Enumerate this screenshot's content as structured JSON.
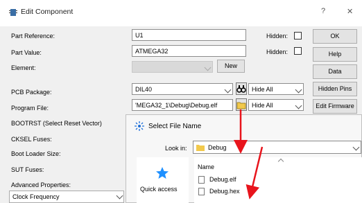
{
  "window": {
    "title": "Edit Component",
    "help": "?",
    "close": "✕"
  },
  "form": {
    "part_reference": {
      "label": "Part Reference:",
      "value": "U1",
      "hidden_label": "Hidden:"
    },
    "part_value": {
      "label": "Part Value:",
      "value": "ATMEGA32",
      "hidden_label": "Hidden:"
    },
    "element": {
      "label": "Element:",
      "new_button": "New"
    },
    "pcb_package": {
      "label": "PCB Package:",
      "value": "DIL40",
      "hide_option": "Hide All"
    },
    "program_file": {
      "label": "Program File:",
      "value": "'MEGA32_1\\Debug\\Debug.elf",
      "hide_option": "Hide All"
    },
    "bootrst": {
      "label": "BOOTRST (Select Reset Vector)"
    },
    "cksel": {
      "label": "CKSEL Fuses:"
    },
    "boot_loader": {
      "label": "Boot Loader Size:"
    },
    "sut": {
      "label": "SUT Fuses:"
    },
    "advanced": {
      "label": "Advanced Properties:"
    },
    "clock": {
      "label": "Clock Frequency"
    }
  },
  "side_buttons": {
    "ok": "OK",
    "help": "Help",
    "data": "Data",
    "hidden_pins": "Hidden Pins",
    "edit_firmware": "Edit Firmware"
  },
  "file_dialog": {
    "title": "Select File Name",
    "look_in_label": "Look in:",
    "look_in_value": "Debug",
    "quick_access": "Quick access",
    "column_name": "Name",
    "files": [
      {
        "name": "Debug.elf"
      },
      {
        "name": "Debug.hex"
      }
    ]
  },
  "colors": {
    "arrow": "#e8141c",
    "folder": "#f2c94c",
    "accent": "#1e90ff"
  }
}
